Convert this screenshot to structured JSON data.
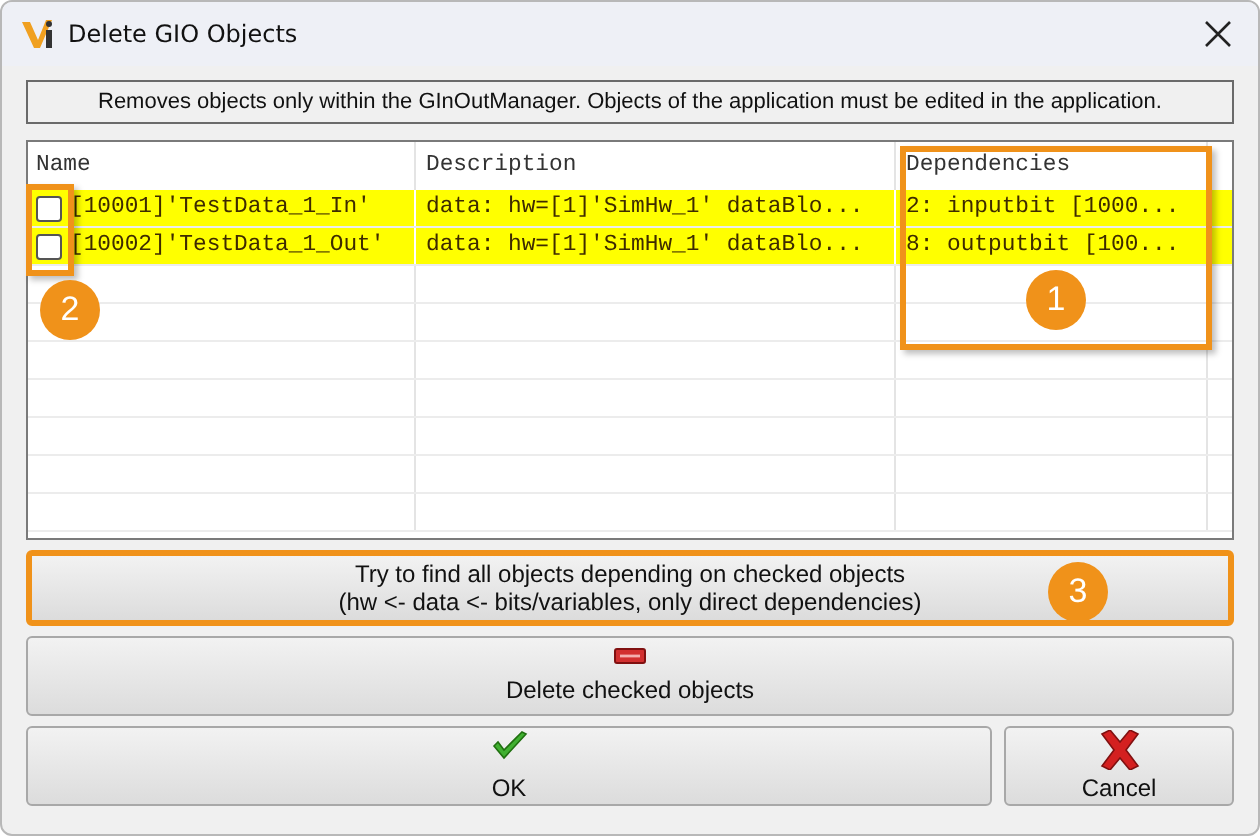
{
  "window": {
    "title": "Delete GIO Objects"
  },
  "info": "Removes objects only within the GInOutManager. Objects of the application must be edited in the application.",
  "table": {
    "columns": [
      "Name",
      "Description",
      "Dependencies"
    ],
    "rows": [
      {
        "checked": false,
        "highlighted": true,
        "cells": [
          "[10001]'TestData_1_In'",
          "data: hw=[1]'SimHw_1' dataBlo...",
          "2: inputbit [1000..."
        ]
      },
      {
        "checked": false,
        "highlighted": true,
        "cells": [
          "[10002]'TestData_1_Out'",
          "data: hw=[1]'SimHw_1' dataBlo...",
          "8: outputbit [100..."
        ]
      }
    ]
  },
  "find_button": {
    "lines": [
      "Try to find all objects depending on checked objects",
      "(hw <- data <- bits/variables, only direct dependencies)"
    ]
  },
  "delete_button": "Delete checked objects",
  "ok_button": "OK",
  "cancel_button": "Cancel",
  "callouts": [
    {
      "kind": "frame",
      "label": "1"
    },
    {
      "kind": "frame",
      "label": "2"
    },
    {
      "kind": "button",
      "label": "3"
    }
  ]
}
